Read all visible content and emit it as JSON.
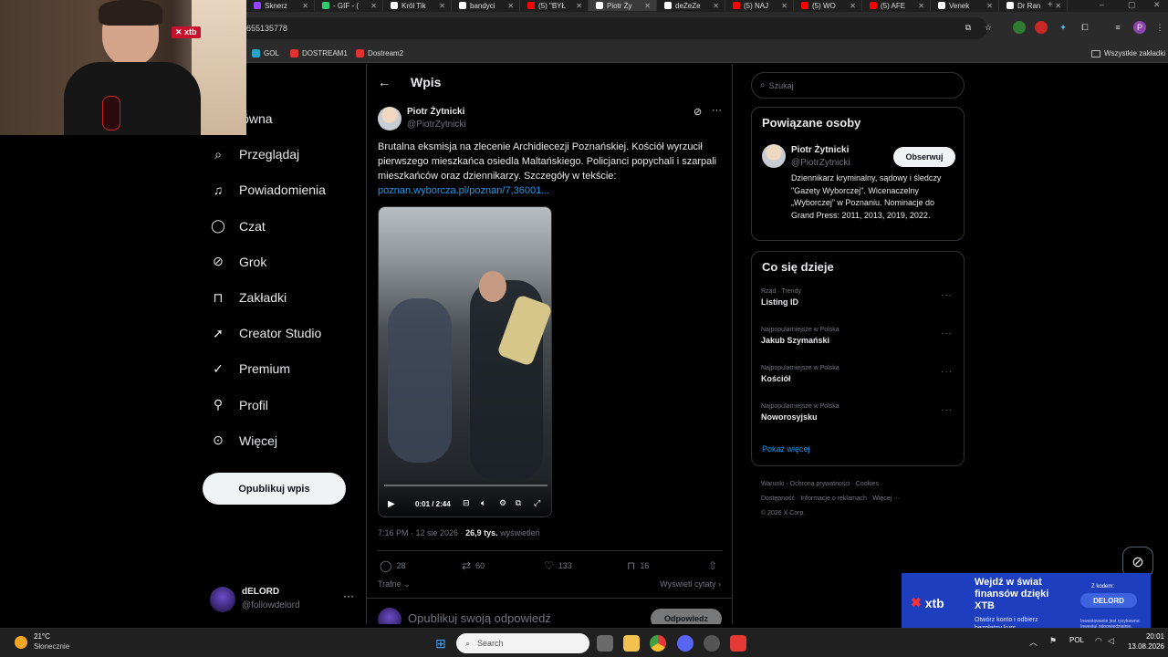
{
  "browser": {
    "tabs": [
      {
        "label": "Sknerz",
        "color": "#9146ff",
        "active": false
      },
      {
        "label": "- GIF - (",
        "color": "#2ecc71",
        "active": false
      },
      {
        "label": "Król Tik",
        "color": "#ffffff",
        "active": false
      },
      {
        "label": "bandyci",
        "color": "#ffffff",
        "active": false
      },
      {
        "label": "(5) \"BYŁ",
        "color": "#ff0000",
        "active": false
      },
      {
        "label": "Piotr Ży",
        "color": "#ffffff",
        "active": true
      },
      {
        "label": "deZeZe",
        "color": "#ffffff",
        "active": false
      },
      {
        "label": "(5) NAJ",
        "color": "#ff0000",
        "active": false
      },
      {
        "label": "(5) WO",
        "color": "#ff0000",
        "active": false
      },
      {
        "label": "(5) AFE",
        "color": "#ff0000",
        "active": false
      },
      {
        "label": "Venek",
        "color": "#ffffff",
        "active": false
      },
      {
        "label": "Dr Ran",
        "color": "#ffffff",
        "active": false
      }
    ],
    "url": "655135778",
    "bookmarks": [
      {
        "label": "GOL",
        "color": "#2aa3c9"
      },
      {
        "label": "DOSTREAM1",
        "color": "#e03030"
      },
      {
        "label": "Dostream2",
        "color": "#e03030"
      }
    ],
    "all_bookmarks": "Wszystkie zakładki"
  },
  "nav": {
    "items": [
      {
        "label": "łówna",
        "icon": "home-icon"
      },
      {
        "label": "Przeglądaj",
        "icon": "search-icon"
      },
      {
        "label": "Powiadomienia",
        "icon": "bell-icon"
      },
      {
        "label": "Czat",
        "icon": "chat-icon"
      },
      {
        "label": "Grok",
        "icon": "grok-icon"
      },
      {
        "label": "Zakładki",
        "icon": "bookmark-icon"
      },
      {
        "label": "Creator Studio",
        "icon": "rocket-icon"
      },
      {
        "label": "Premium",
        "icon": "verified-icon"
      },
      {
        "label": "Profil",
        "icon": "person-icon"
      },
      {
        "label": "Więcej",
        "icon": "more-circle-icon"
      }
    ],
    "publish": "Opublikuj wpis",
    "account": {
      "name": "dELORD",
      "handle": "@followdelord"
    }
  },
  "main": {
    "title": "Wpis",
    "author": {
      "name": "Piotr Żytnicki",
      "handle": "@PiotrZytnicki"
    },
    "text": "Brutalna eksmisja na zlecenie Archidiecezji Poznańskiej. Kościół wyrzucił pierwszego mieszkańca osiedla Maltańskiego. Policjanci popychali i szarpali mieszkańców oraz dziennikarzy. Szczegóły w tekście:",
    "link": "poznan.wyborcza.pl/poznan/7,36001...",
    "video": {
      "time": "0:01 / 2:44",
      "progress": 0.006
    },
    "meta": {
      "datetime": "7:16 PM · 12 sie 2026 · ",
      "views": "26,9 tys.",
      "views_label": " wyświetleń"
    },
    "stats": {
      "replies": "28",
      "reposts": "60",
      "likes": "133",
      "bookmarks": "16"
    },
    "sort": "Trafne",
    "quotes": "Wyświetl cytaty",
    "reply_placeholder": "Opublikuj swoją odpowiedź",
    "reply_button": "Odpowiedz"
  },
  "sidebar": {
    "search_placeholder": "Szukaj",
    "related": {
      "title": "Powiązane osoby",
      "name": "Piotr Żytnicki",
      "handle": "@PiotrZytnicki",
      "follow": "Obserwuj",
      "bio": "Dziennikarz kryminalny, sądowy i śledczy \"Gazety Wyborczej\". Wicenaczelny „Wyborczej” w Poznaniu. Nominacje do Grand Press: 2011, 2013, 2019, 2022."
    },
    "trends": {
      "title": "Co się dzieje",
      "items": [
        {
          "context": "Rząd · Trendy",
          "name": "Listing ID"
        },
        {
          "context": "Najpopularniejsze w Polska",
          "name": "Jakub Szymański"
        },
        {
          "context": "Najpopularniejsze w Polska",
          "name": "Kościół"
        },
        {
          "context": "Najpopularniejsze w Polska",
          "name": "Noworosyjsku"
        }
      ],
      "more": "Pokaż więcej"
    },
    "footer": {
      "l1": "Warunki",
      "l2": "Ochrona prywatności",
      "l3": "Cookies",
      "l4": "Dostępność",
      "l5": "Informacje o reklamach",
      "l6": "Więcej ···",
      "copyright": "© 2026 X Corp."
    }
  },
  "stream": {
    "webcam_badge": "xtb",
    "ad": {
      "headline": "Wejdź w świat finansów dzięki XTB",
      "sub": "Otwórz konto i odbierz bezpłatny kurs",
      "code_label": "Z kodem:",
      "code": "DELORD",
      "logo": "xtb",
      "disclaimer": "Inwestowanie jest ryzykowne. Inwestuj odpowiedzialnie."
    }
  },
  "taskbar": {
    "temp": "21°C",
    "weather": "Słonecznie",
    "search": "Search",
    "lang": "POL",
    "time": "20:01",
    "date": "13.08.2026"
  }
}
